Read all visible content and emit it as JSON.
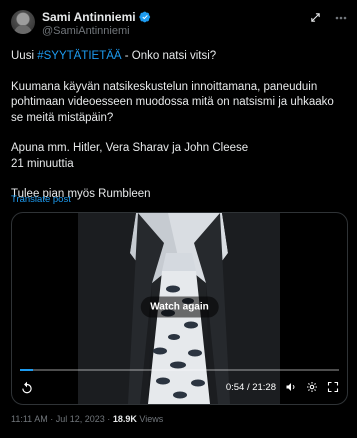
{
  "author": {
    "name": "Sami Antinniemi",
    "handle": "@SamiAntinniemi"
  },
  "tweet": {
    "line1_prefix": "Uusi ",
    "hashtag": "#SYYTÄTIETÄÄ",
    "line1_suffix": " - Onko natsi vitsi?",
    "paragraph2": "Kuumana käyvän natsikeskustelun innoittamana, paneuduin pohtimaan videoesseen muodossa mitä on natsismi ja uhkaako se meitä mistäpäin?",
    "line3": "Apuna mm. Hitler, Vera Sharav ja John Cleese",
    "line4": "21 minuuttia",
    "line5": "Tulee pian myös Rumbleen",
    "translate_label": "Translate post"
  },
  "video": {
    "watch_again_label": "Watch again",
    "time_display": "0:54 / 21:28",
    "progress": 0.042
  },
  "meta": {
    "time": "11:11 AM",
    "date": "Jul 12, 2023",
    "separator": "·",
    "views_count": "18.9K",
    "views_label": "Views"
  },
  "colors": {
    "accent": "#1d9bf0",
    "background": "#000000",
    "text": "#e7e9ea",
    "muted": "#71767b"
  },
  "icons": [
    "verified-badge-icon",
    "grok-icon",
    "more-icon",
    "replay-icon",
    "volume-icon",
    "settings-icon",
    "fullscreen-icon"
  ]
}
